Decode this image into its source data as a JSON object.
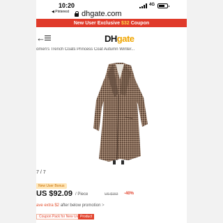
{
  "status_bar": {
    "time": "10:20",
    "back_app": "◀ Pinterest",
    "network": "4G"
  },
  "browser": {
    "url": "dhgate.com"
  },
  "banner": {
    "prefix": "New User Exclusive",
    "amount": "$32",
    "suffix": "Coupon",
    "color": "#e03a2a"
  },
  "header": {
    "back_label": "←",
    "logo_dh": "DH",
    "logo_gate": "gate",
    "logo_gate_color": "#f0a500"
  },
  "product": {
    "title": "omen's Trench Coats Princess Coat Autumn Winter...",
    "image_counter": "7 / 7",
    "image_subject": "houndstooth-wool-long-coat"
  },
  "pricing": {
    "new_user_badge": "New User Bonus",
    "price": "US $92.09",
    "per_unit": "/ Piece",
    "original_price": "US $153",
    "discount": "-40%"
  },
  "promo": {
    "line_highlight": "ave extra $2",
    "line_rest": "after below promotion",
    "arrow": ">"
  },
  "coupon": {
    "chip": "Coupon Pack for New User",
    "tag": "Product"
  }
}
